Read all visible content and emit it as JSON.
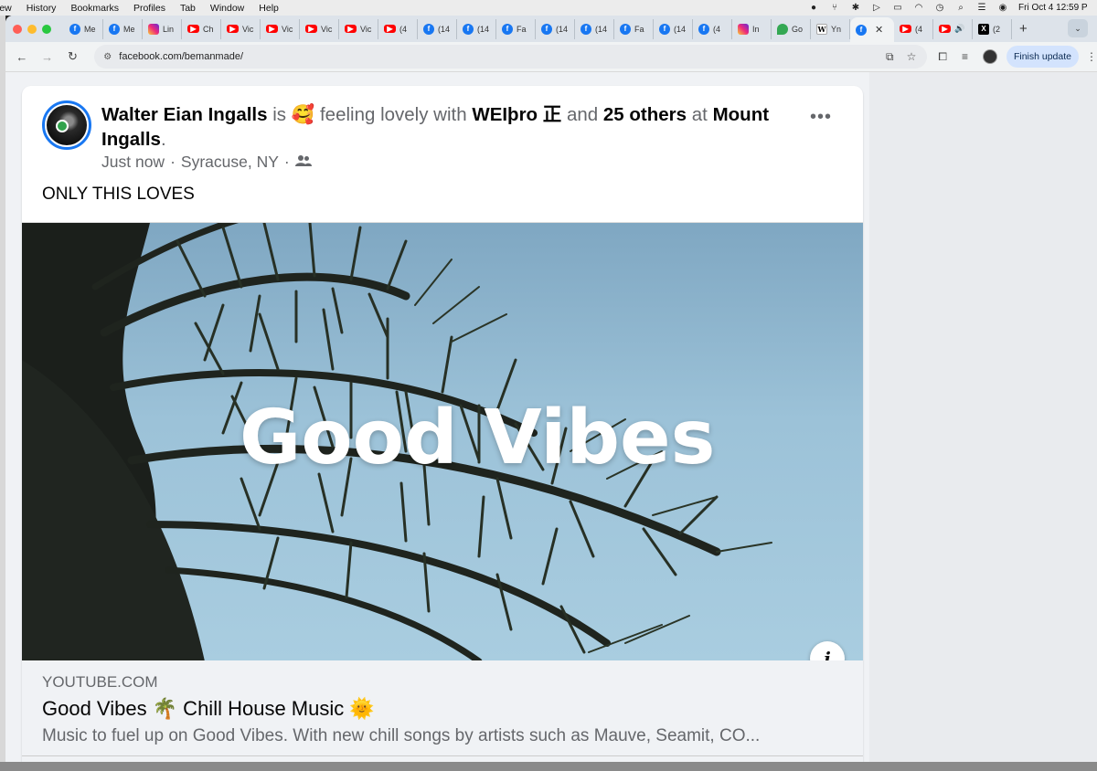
{
  "menubar": {
    "items": [
      "iew",
      "History",
      "Bookmarks",
      "Profiles",
      "Tab",
      "Window",
      "Help"
    ],
    "clock": "Fri Oct 4  12:59 P"
  },
  "tabs": [
    {
      "icon": "facebook-icon",
      "label": "Me"
    },
    {
      "icon": "facebook-icon",
      "label": "Me"
    },
    {
      "icon": "instagram-icon",
      "label": "Lin"
    },
    {
      "icon": "youtube-icon",
      "label": "Ch"
    },
    {
      "icon": "youtube-icon",
      "label": "Vic"
    },
    {
      "icon": "youtube-icon",
      "label": "Vic"
    },
    {
      "icon": "youtube-icon",
      "label": "Vic"
    },
    {
      "icon": "youtube-icon",
      "label": "Vic"
    },
    {
      "icon": "youtube-icon",
      "label": "(4"
    },
    {
      "icon": "facebook-icon",
      "label": "(14"
    },
    {
      "icon": "facebook-icon",
      "label": "(14"
    },
    {
      "icon": "facebook-icon",
      "label": "Fa"
    },
    {
      "icon": "facebook-icon",
      "label": "(14"
    },
    {
      "icon": "facebook-icon",
      "label": "(14"
    },
    {
      "icon": "facebook-icon",
      "label": "Fa"
    },
    {
      "icon": "facebook-icon",
      "label": "(14"
    },
    {
      "icon": "facebook-icon",
      "label": "(4"
    },
    {
      "icon": "instagram-icon",
      "label": "In"
    },
    {
      "icon": "maps-icon",
      "label": "Go"
    },
    {
      "icon": "wikipedia-icon",
      "label": "Yn"
    }
  ],
  "active_tab": {
    "icon": "facebook-icon",
    "close": "✕"
  },
  "tabs_after": [
    {
      "icon": "youtube-icon",
      "label": "(4"
    },
    {
      "icon": "youtube-icon",
      "label": "🔊"
    },
    {
      "icon": "x-icon",
      "label": "(2"
    }
  ],
  "toolbar": {
    "url": "facebook.com/bemanmade/",
    "finish_update": "Finish update"
  },
  "post": {
    "author": "Walter Eian Ingalls",
    "is": "is",
    "feeling_emoji": "🥰",
    "feeling": "feeling lovely with",
    "tagged": "WEIþro 正",
    "and": "and",
    "others": "25 others",
    "at": "at",
    "place": "Mount Ingalls",
    "time": "Just now",
    "location": "Syracuse, NY",
    "more": "•••",
    "text": "ONLY THIS LOVES",
    "media_title": "Good Vibes",
    "info": "i",
    "link_domain": "YOUTUBE.COM",
    "link_title": "Good Vibes 🌴 Chill House Music 🌞",
    "link_desc": "Music to fuel up on Good Vibes. With new chill songs by artists such as Mauve, Seamit, CO..."
  },
  "colors": {
    "facebook_blue": "#1877f2",
    "online_green": "#31a24c",
    "sky": "#a9cde0"
  }
}
